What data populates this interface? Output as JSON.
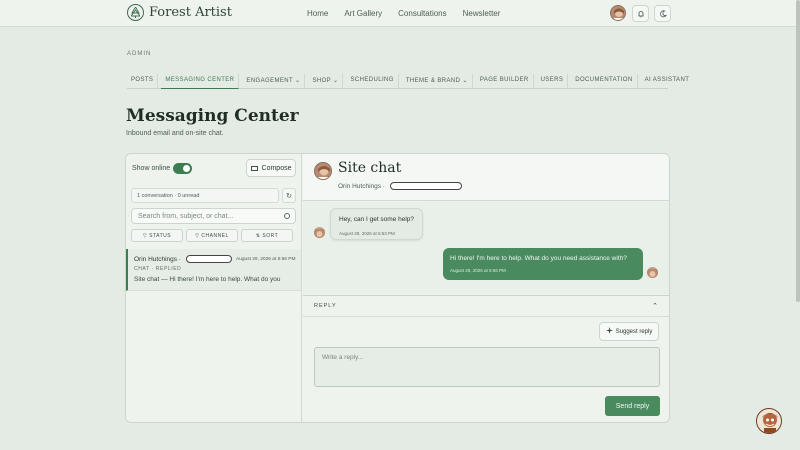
{
  "brand": {
    "name": "Forest Artist"
  },
  "topnav": [
    "Home",
    "Art Gallery",
    "Consultations",
    "Newsletter"
  ],
  "icons": {
    "logo": "tree-icon",
    "bell": "bell-icon",
    "theme": "moon-icon"
  },
  "admin": {
    "label": "ADMIN",
    "subnav": [
      "POSTS",
      "MESSAGING CENTER",
      "ENGAGEMENT ⌄",
      "SHOP ⌄",
      "SCHEDULING",
      "THEME & BRAND ⌄",
      "PAGE BUILDER",
      "USERS",
      "DOCUMENTATION",
      "AI ASSISTANT"
    ],
    "active_tab": "MESSAGING CENTER"
  },
  "page": {
    "title": "Messaging Center",
    "subtitle": "Inbound email and on-site chat."
  },
  "inbox": {
    "show_online": "Show online",
    "show_online_on": true,
    "compose_label": "Compose",
    "count_text": "1 conversation · 0 unread",
    "search_placeholder": "Search from, subject, or chat...",
    "filters": [
      "▽ STATUS",
      "▽ CHANNEL",
      "⇅ SORT"
    ],
    "conversations": [
      {
        "name": "Orin Hutchings ·",
        "date": "August 29, 2026 at 6:56 PM",
        "tags": "CHAT · REPLIED",
        "preview": "Site chat — Hi there! I'm here to help. What do you"
      }
    ]
  },
  "chat": {
    "title": "Site chat",
    "contact": "Orin Hutchings ·",
    "messages": [
      {
        "direction": "in",
        "text": "Hey, can I get some help?",
        "time": "August 29, 2026 at 6:53 PM"
      },
      {
        "direction": "out",
        "text": "Hi there! I'm here to help. What do you need assistance with?",
        "time": "August 29, 2026 at 6:56 PM"
      }
    ]
  },
  "reply": {
    "label": "REPLY",
    "chevron": "⌃",
    "suggest_label": "Suggest reply",
    "placeholder": "Write a reply...",
    "send_label": "Send reply"
  },
  "colors": {
    "accent": "#4a8a5f",
    "background": "#e4ebe4"
  }
}
